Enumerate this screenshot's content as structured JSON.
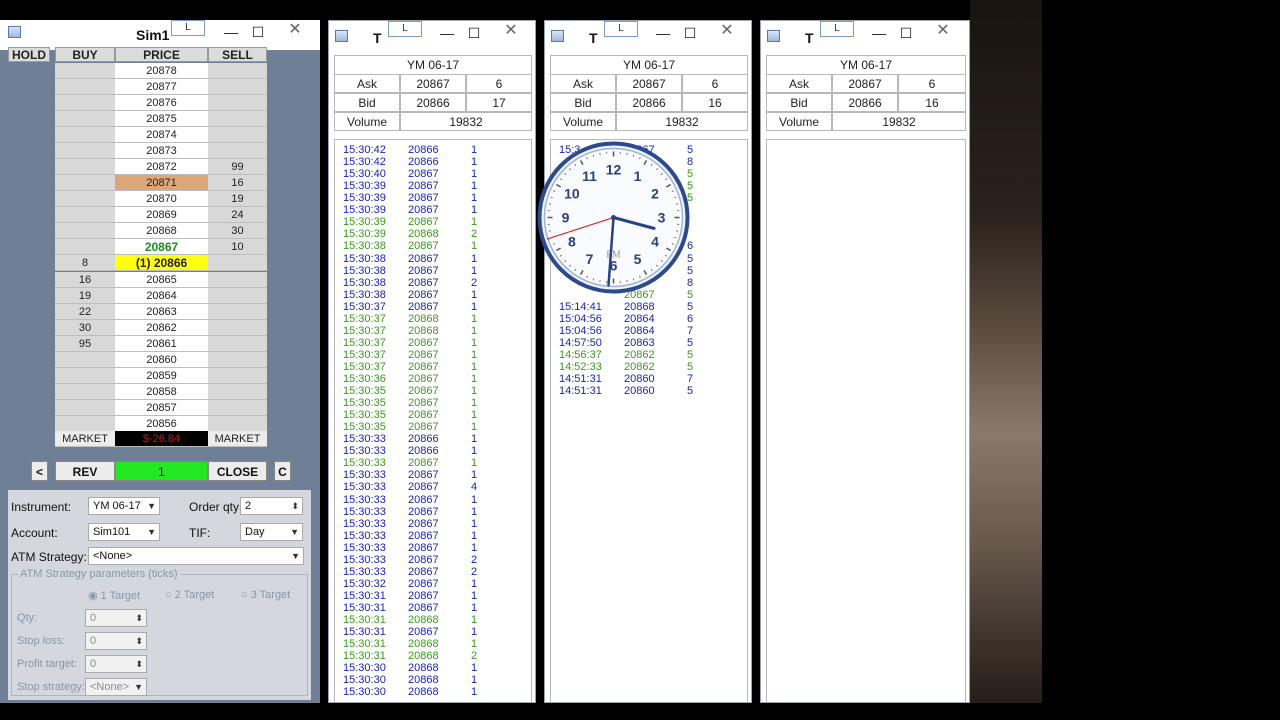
{
  "dom": {
    "title": "Sim1",
    "l_label": "L",
    "min": "—",
    "max": "☐",
    "close": "✕",
    "headers": {
      "hold": "HOLD",
      "buy": "BUY",
      "price": "PRICE",
      "sell": "SELL"
    },
    "rows": [
      {
        "buy": "",
        "price": "20878",
        "sell": ""
      },
      {
        "buy": "",
        "price": "20877",
        "sell": ""
      },
      {
        "buy": "",
        "price": "20876",
        "sell": ""
      },
      {
        "buy": "",
        "price": "20875",
        "sell": ""
      },
      {
        "buy": "",
        "price": "20874",
        "sell": ""
      },
      {
        "buy": "",
        "price": "20873",
        "sell": ""
      },
      {
        "buy": "",
        "price": "20872",
        "sell": "99"
      },
      {
        "buy": "",
        "price": "20871",
        "sell": "16",
        "hl": "orange"
      },
      {
        "buy": "",
        "price": "20870",
        "sell": "19"
      },
      {
        "buy": "",
        "price": "20869",
        "sell": "24"
      },
      {
        "buy": "",
        "price": "20868",
        "sell": "30"
      },
      {
        "buy": "",
        "price": "20867",
        "sell": "10",
        "hl": "green"
      },
      {
        "buy": "8",
        "price": "(1) 20866",
        "sell": "",
        "hl": "yellow"
      },
      {
        "buy": "16",
        "price": "20865",
        "sell": ""
      },
      {
        "buy": "19",
        "price": "20864",
        "sell": ""
      },
      {
        "buy": "22",
        "price": "20863",
        "sell": ""
      },
      {
        "buy": "30",
        "price": "20862",
        "sell": ""
      },
      {
        "buy": "95",
        "price": "20861",
        "sell": ""
      },
      {
        "buy": "",
        "price": "20860",
        "sell": ""
      },
      {
        "buy": "",
        "price": "20859",
        "sell": ""
      },
      {
        "buy": "",
        "price": "20858",
        "sell": ""
      },
      {
        "buy": "",
        "price": "20857",
        "sell": ""
      },
      {
        "buy": "",
        "price": "20856",
        "sell": ""
      }
    ],
    "market_buy": "MARKET",
    "pnl": "$-26.84",
    "market_sell": "MARKET",
    "btn_prev": "<",
    "btn_rev": "REV",
    "position": "1",
    "btn_close": "CLOSE",
    "btn_c": "C",
    "instrument_label": "Instrument:",
    "instrument_value": "YM 06-17",
    "order_qty_label": "Order qty:",
    "order_qty_value": "2",
    "account_label": "Account:",
    "account_value": "Sim101",
    "tif_label": "TIF:",
    "tif_value": "Day",
    "atm_label": "ATM Strategy:",
    "atm_value": "<None>",
    "atm_params_label": "ATM Strategy parameters (ticks)",
    "targets": [
      "1 Target",
      "2 Target",
      "3 Target"
    ],
    "qty_label": "Qty:",
    "qty_value": "0",
    "stoploss_label": "Stop loss:",
    "stoploss_value": "0",
    "profit_label": "Profit target:",
    "profit_value": "0",
    "stopstrat_label": "Stop strategy:",
    "stopstrat_value": "<None>"
  },
  "ts_windows": [
    {
      "title": "T",
      "instrument": "YM 06-17",
      "ask_label": "Ask",
      "ask": "20867",
      "ask_size": "6",
      "bid_label": "Bid",
      "bid": "20866",
      "bid_size": "17",
      "volume_label": "Volume",
      "volume": "19832",
      "trades": [
        [
          "15:30:42",
          "20866",
          "1",
          "b"
        ],
        [
          "15:30:42",
          "20866",
          "1",
          "b"
        ],
        [
          "15:30:40",
          "20867",
          "1",
          "b"
        ],
        [
          "15:30:39",
          "20867",
          "1",
          "b"
        ],
        [
          "15:30:39",
          "20867",
          "1",
          "b"
        ],
        [
          "15:30:39",
          "20867",
          "1",
          "b"
        ],
        [
          "15:30:39",
          "20867",
          "1",
          "g"
        ],
        [
          "15:30:39",
          "20868",
          "2",
          "g"
        ],
        [
          "15:30:38",
          "20867",
          "1",
          "g"
        ],
        [
          "15:30:38",
          "20867",
          "1",
          "b"
        ],
        [
          "15:30:38",
          "20867",
          "1",
          "b"
        ],
        [
          "15:30:38",
          "20867",
          "2",
          "b"
        ],
        [
          "15:30:38",
          "20867",
          "1",
          "b"
        ],
        [
          "15:30:37",
          "20867",
          "1",
          "b"
        ],
        [
          "15:30:37",
          "20868",
          "1",
          "g"
        ],
        [
          "15:30:37",
          "20868",
          "1",
          "g"
        ],
        [
          "15:30:37",
          "20867",
          "1",
          "g"
        ],
        [
          "15:30:37",
          "20867",
          "1",
          "g"
        ],
        [
          "15:30:37",
          "20867",
          "1",
          "g"
        ],
        [
          "15:30:36",
          "20867",
          "1",
          "g"
        ],
        [
          "15:30:35",
          "20867",
          "1",
          "g"
        ],
        [
          "15:30:35",
          "20867",
          "1",
          "g"
        ],
        [
          "15:30:35",
          "20867",
          "1",
          "g"
        ],
        [
          "15:30:35",
          "20867",
          "1",
          "g"
        ],
        [
          "15:30:33",
          "20866",
          "1",
          "b"
        ],
        [
          "15:30:33",
          "20866",
          "1",
          "b"
        ],
        [
          "15:30:33",
          "20867",
          "1",
          "g"
        ],
        [
          "15:30:33",
          "20867",
          "1",
          "b"
        ],
        [
          "15:30:33",
          "20867",
          "4",
          "b"
        ],
        [
          "15:30:33",
          "20867",
          "1",
          "b"
        ],
        [
          "15:30:33",
          "20867",
          "1",
          "b"
        ],
        [
          "15:30:33",
          "20867",
          "1",
          "b"
        ],
        [
          "15:30:33",
          "20867",
          "1",
          "b"
        ],
        [
          "15:30:33",
          "20867",
          "1",
          "b"
        ],
        [
          "15:30:33",
          "20867",
          "2",
          "b"
        ],
        [
          "15:30:33",
          "20867",
          "2",
          "b"
        ],
        [
          "15:30:32",
          "20867",
          "1",
          "b"
        ],
        [
          "15:30:31",
          "20867",
          "1",
          "b"
        ],
        [
          "15:30:31",
          "20867",
          "1",
          "b"
        ],
        [
          "15:30:31",
          "20868",
          "1",
          "g"
        ],
        [
          "15:30:31",
          "20867",
          "1",
          "b"
        ],
        [
          "15:30:31",
          "20868",
          "1",
          "g"
        ],
        [
          "15:30:31",
          "20868",
          "2",
          "g"
        ],
        [
          "15:30:30",
          "20868",
          "1",
          "b"
        ],
        [
          "15:30:30",
          "20868",
          "1",
          "b"
        ],
        [
          "15:30:30",
          "20868",
          "1",
          "b"
        ]
      ]
    },
    {
      "title": "T",
      "instrument": "YM 06-17",
      "ask_label": "Ask",
      "ask": "20867",
      "ask_size": "6",
      "bid_label": "Bid",
      "bid": "20866",
      "bid_size": "16",
      "volume_label": "Volume",
      "volume": "19832",
      "trades": [
        [
          "15:3",
          "20867",
          "5",
          "b"
        ],
        [
          "",
          "",
          "8",
          "b"
        ],
        [
          "",
          "",
          "5",
          "g"
        ],
        [
          "",
          "",
          "5",
          "g"
        ],
        [
          "",
          "",
          "5",
          "g"
        ],
        [
          "",
          "",
          "",
          "b"
        ],
        [
          "",
          "",
          "",
          "b"
        ],
        [
          "",
          "",
          "",
          "b"
        ],
        [
          "",
          "",
          "6",
          "b"
        ],
        [
          "",
          "",
          "5",
          "b"
        ],
        [
          "",
          "",
          "5",
          "b"
        ],
        [
          "",
          "",
          "8",
          "b"
        ],
        [
          "",
          "20867",
          "5",
          "g"
        ],
        [
          "15:14:41",
          "20868",
          "5",
          "b"
        ],
        [
          "15:04:56",
          "20864",
          "6",
          "b"
        ],
        [
          "15:04:56",
          "20864",
          "7",
          "b"
        ],
        [
          "14:57:50",
          "20863",
          "5",
          "b"
        ],
        [
          "14:56:37",
          "20862",
          "5",
          "g"
        ],
        [
          "14:52:33",
          "20862",
          "5",
          "g"
        ],
        [
          "14:51:31",
          "20860",
          "7",
          "b"
        ],
        [
          "14:51:31",
          "20860",
          "5",
          "b"
        ]
      ]
    },
    {
      "title": "T",
      "instrument": "YM 06-17",
      "ask_label": "Ask",
      "ask": "20867",
      "ask_size": "6",
      "bid_label": "Bid",
      "bid": "20866",
      "bid_size": "16",
      "volume_label": "Volume",
      "volume": "19832",
      "trades": []
    }
  ],
  "clock": {
    "numbers": [
      "12",
      "1",
      "2",
      "3",
      "4",
      "5",
      "6",
      "7",
      "8",
      "9",
      "10",
      "11"
    ],
    "ampm": "PM",
    "hour": 3,
    "minute": 30,
    "second": 42
  }
}
